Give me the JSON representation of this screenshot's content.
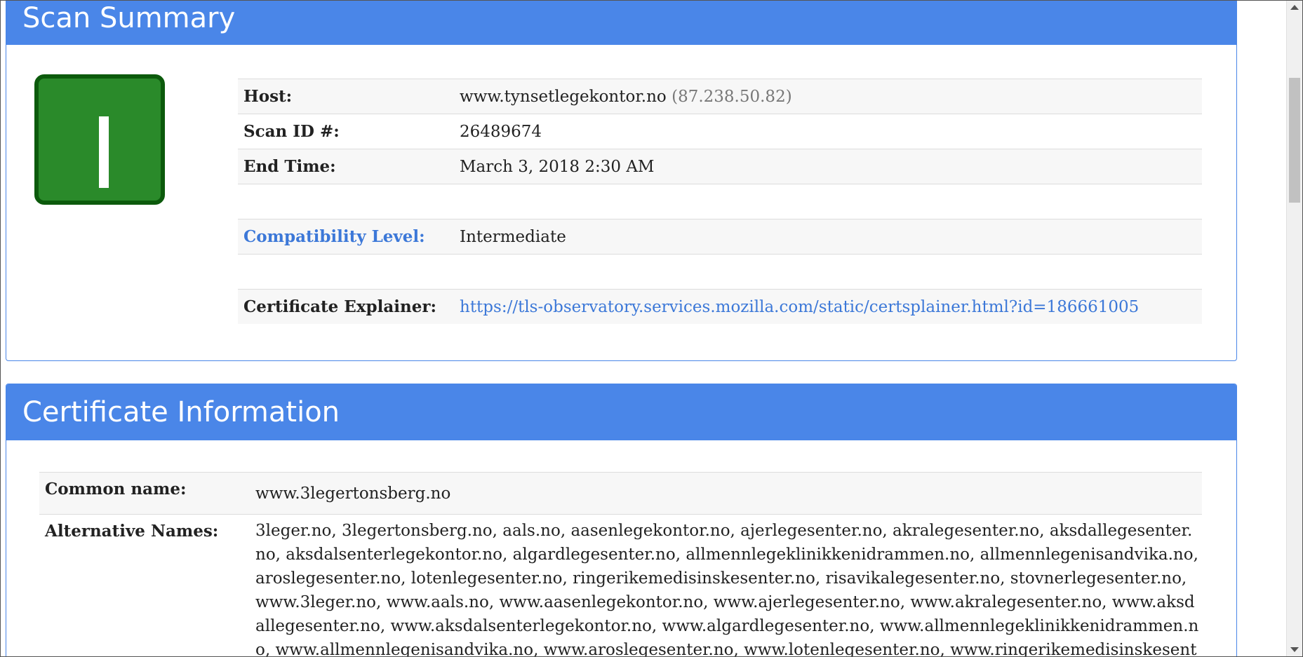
{
  "scan_summary": {
    "title": "Scan Summary",
    "grade_icon": "grade-badge-icon",
    "grade_color": "#2a8a2a",
    "host_label": "Host:",
    "host_value": "www.tynsetlegekontor.no",
    "host_ip": "(87.238.50.82)",
    "scan_id_label": "Scan ID #:",
    "scan_id_value": "26489674",
    "end_time_label": "End Time:",
    "end_time_value": "March 3, 2018 2:30 AM",
    "compat_label": "Compatibility Level:",
    "compat_value": "Intermediate",
    "cert_explainer_label": "Certificate Explainer:",
    "cert_explainer_url": "https://tls-observatory.services.mozilla.com/static/certsplainer.html?id=186661005"
  },
  "certificate_info": {
    "title": "Certificate Information",
    "common_name_label": "Common name:",
    "common_name_value": "www.3legertonsberg.no",
    "alt_names_label": "Alternative Names:",
    "alt_names_value": "3leger.no, 3legertonsberg.no, aals.no, aasenlegekontor.no, ajerlegesenter.no, akralegesenter.no, aksdallegesenter.no, aksdalsenterlegekontor.no, algardlegesenter.no, allmennlegeklinikkenidrammen.no, allmennlegenisandvika.no, aroslegesenter.no, lotenlegesenter.no, ringerikemedisinskesenter.no, risavikalegesenter.no, stovnerlegesenter.no, www.3leger.no, www.aals.no, www.aasenlegekontor.no, www.ajerlegesenter.no, www.akralegesenter.no, www.aksdallegesenter.no, www.aksdalsenterlegekontor.no, www.algardlegesenter.no, www.allmennlegeklinikkenidrammen.no, www.allmennlegenisandvika.no, www.aroslegesenter.no, www.lotenlegesenter.no, www.ringerikemedisinskesenter.no, www.risavikalegesenter.no, www.stovnerlegesenter.no"
  },
  "colors": {
    "header_blue": "#4a86e8",
    "link_blue": "#3c78d8"
  }
}
